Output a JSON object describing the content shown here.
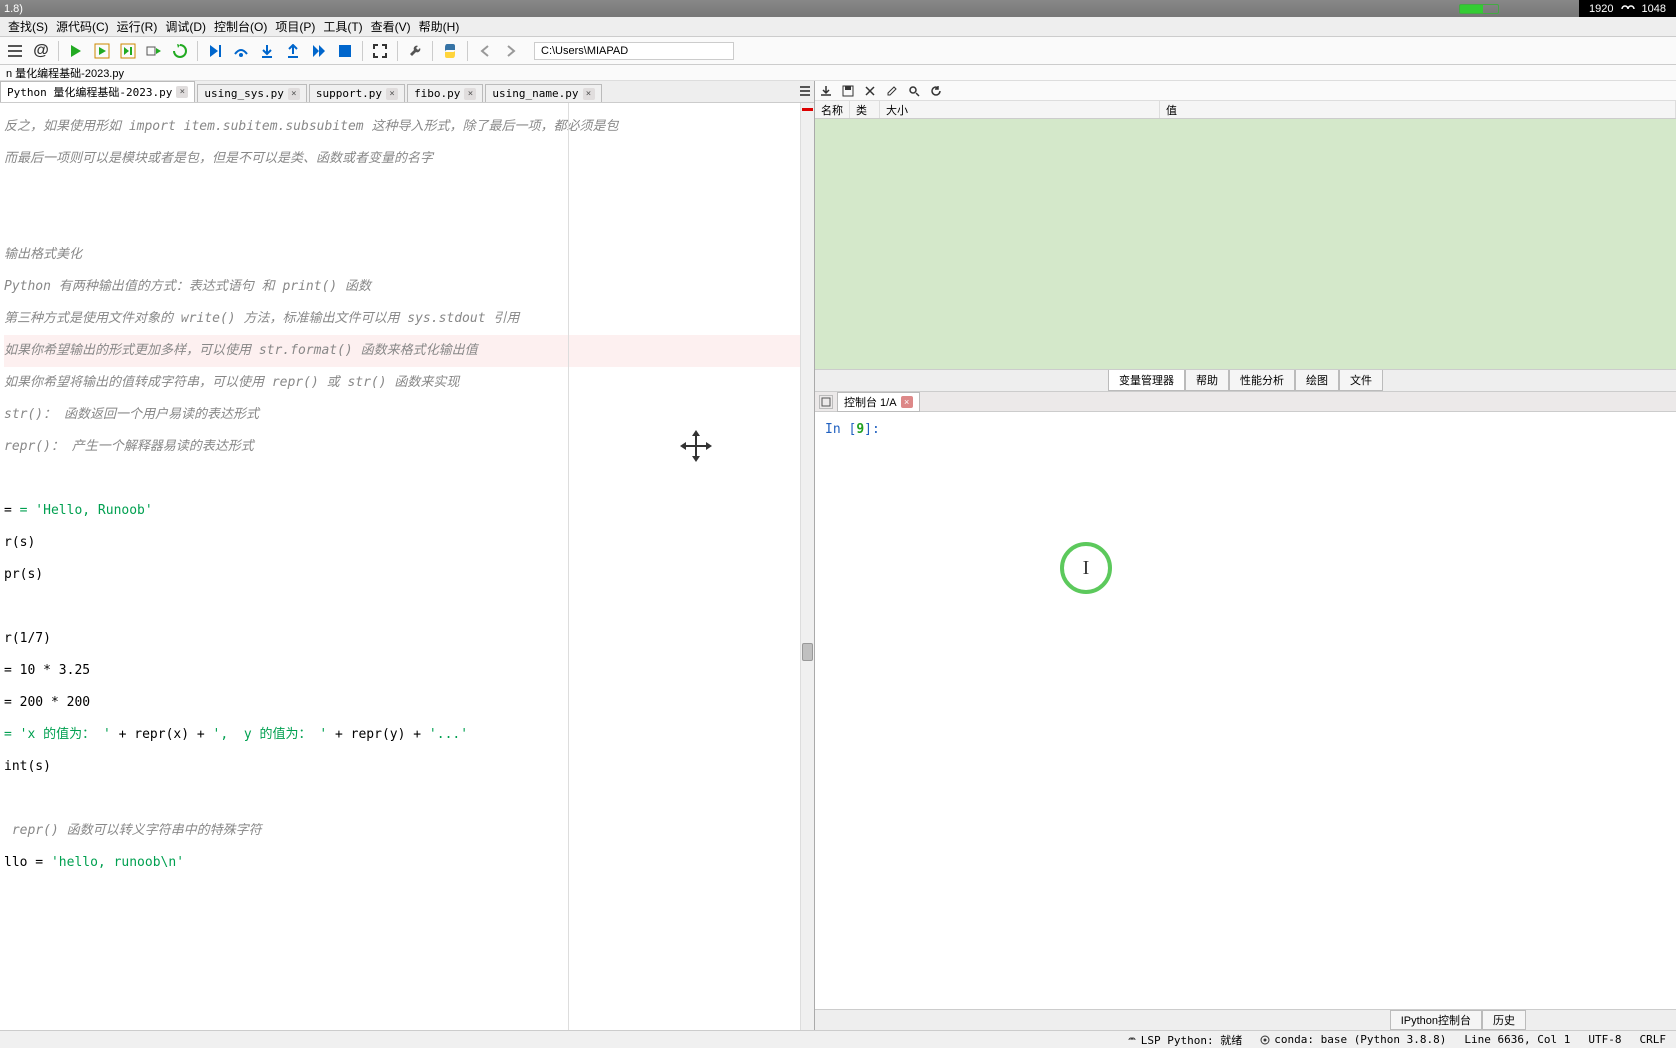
{
  "titlebar": {
    "text": "1.8)"
  },
  "resolution": {
    "w": "1920",
    "h": "1048"
  },
  "menubar": [
    "查找(S)",
    "源代码(C)",
    "运行(R)",
    "调试(D)",
    "控制台(O)",
    "项目(P)",
    "工具(T)",
    "查看(V)",
    "帮助(H)"
  ],
  "path": "C:\\Users\\MIAPAD",
  "breadcrumb": "n 量化编程基础-2023.py",
  "tabs": [
    {
      "label": "Python 量化编程基础-2023.py",
      "active": true
    },
    {
      "label": "using_sys.py",
      "active": false
    },
    {
      "label": "support.py",
      "active": false
    },
    {
      "label": "fibo.py",
      "active": false
    },
    {
      "label": "using_name.py",
      "active": false
    }
  ],
  "code": {
    "l1": "反之，如果使用形如 import item.subitem.subsubitem 这种导入形式，除了最后一项，都必须是包",
    "l2": "而最后一项则可以是模块或者是包，但是不可以是类、函数或者变量的名字",
    "l3": "输出格式美化",
    "l4": "Python 有两种输出值的方式：表达式语句 和 print() 函数",
    "l5": "第三种方式是使用文件对象的 write() 方法，标准输出文件可以用 sys.stdout 引用",
    "l6": "如果你希望输出的形式更加多样，可以使用 str.format() 函数来格式化输出值",
    "l7": "如果你希望将输出的值转成字符串，可以使用 repr() 或 str() 函数来实现",
    "l8": "str()： 函数返回一个用户易读的表达形式",
    "l9": "repr()： 产生一个解释器易读的表达形式",
    "s1": "= 'Hello, Runoob'",
    "p1": "r(s)",
    "p2": "pr(s)",
    "p3": "r(1/7)",
    "p4": "= 10 * 3.25",
    "p5": "= 200 * 200",
    "p6a": "= 'x 的值为： '",
    "p6b": " + repr(x) + ",
    "p6c": "',  y 的值为： '",
    "p6d": " + repr(y) + ",
    "p6e": "'...'",
    "p7": "int(s)",
    "l10": " repr() 函数可以转义字符串中的特殊字符",
    "p8a": "llo = ",
    "p8b": "'hello, runoob\\n'"
  },
  "var_header": {
    "c1": "名称",
    "c2": "类型",
    "c3": "大小",
    "c4": "值"
  },
  "right_tabs": [
    "变量管理器",
    "帮助",
    "性能分析",
    "绘图",
    "文件"
  ],
  "console_tab": "控制台 1/A",
  "console_prompt": {
    "in": "In [",
    "num": "9",
    "close": "]:"
  },
  "bottom_tabs": [
    "IPython控制台",
    "历史"
  ],
  "statusbar": {
    "lsp": "LSP Python: 就绪",
    "conda": "conda: base (Python 3.8.8)",
    "pos": "Line 6636, Col 1",
    "enc": "UTF-8",
    "eol": "CRLF"
  }
}
